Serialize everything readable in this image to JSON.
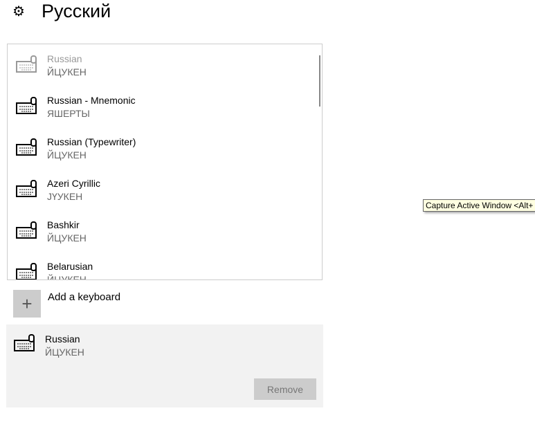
{
  "header": {
    "title": "Русский",
    "icon": "gear-icon"
  },
  "keyboards": [
    {
      "name": "Russian",
      "layout": "ЙЦУКЕН",
      "dimmed": true
    },
    {
      "name": "Russian - Mnemonic",
      "layout": "ЯШЕРТЫ"
    },
    {
      "name": "Russian (Typewriter)",
      "layout": "ЙЦУКЕН"
    },
    {
      "name": "Azeri Cyrillic",
      "layout": "ЈҮУКЕН"
    },
    {
      "name": "Bashkir",
      "layout": "ЙЦУКЕН"
    },
    {
      "name": "Belarusian",
      "layout": "ЙЦУКЕН"
    }
  ],
  "add_keyboard": "Add a keyboard",
  "selected": {
    "name": "Russian",
    "layout": "ЙЦУКЕН",
    "remove_label": "Remove"
  },
  "tooltip": "Capture Active Window <Alt+"
}
